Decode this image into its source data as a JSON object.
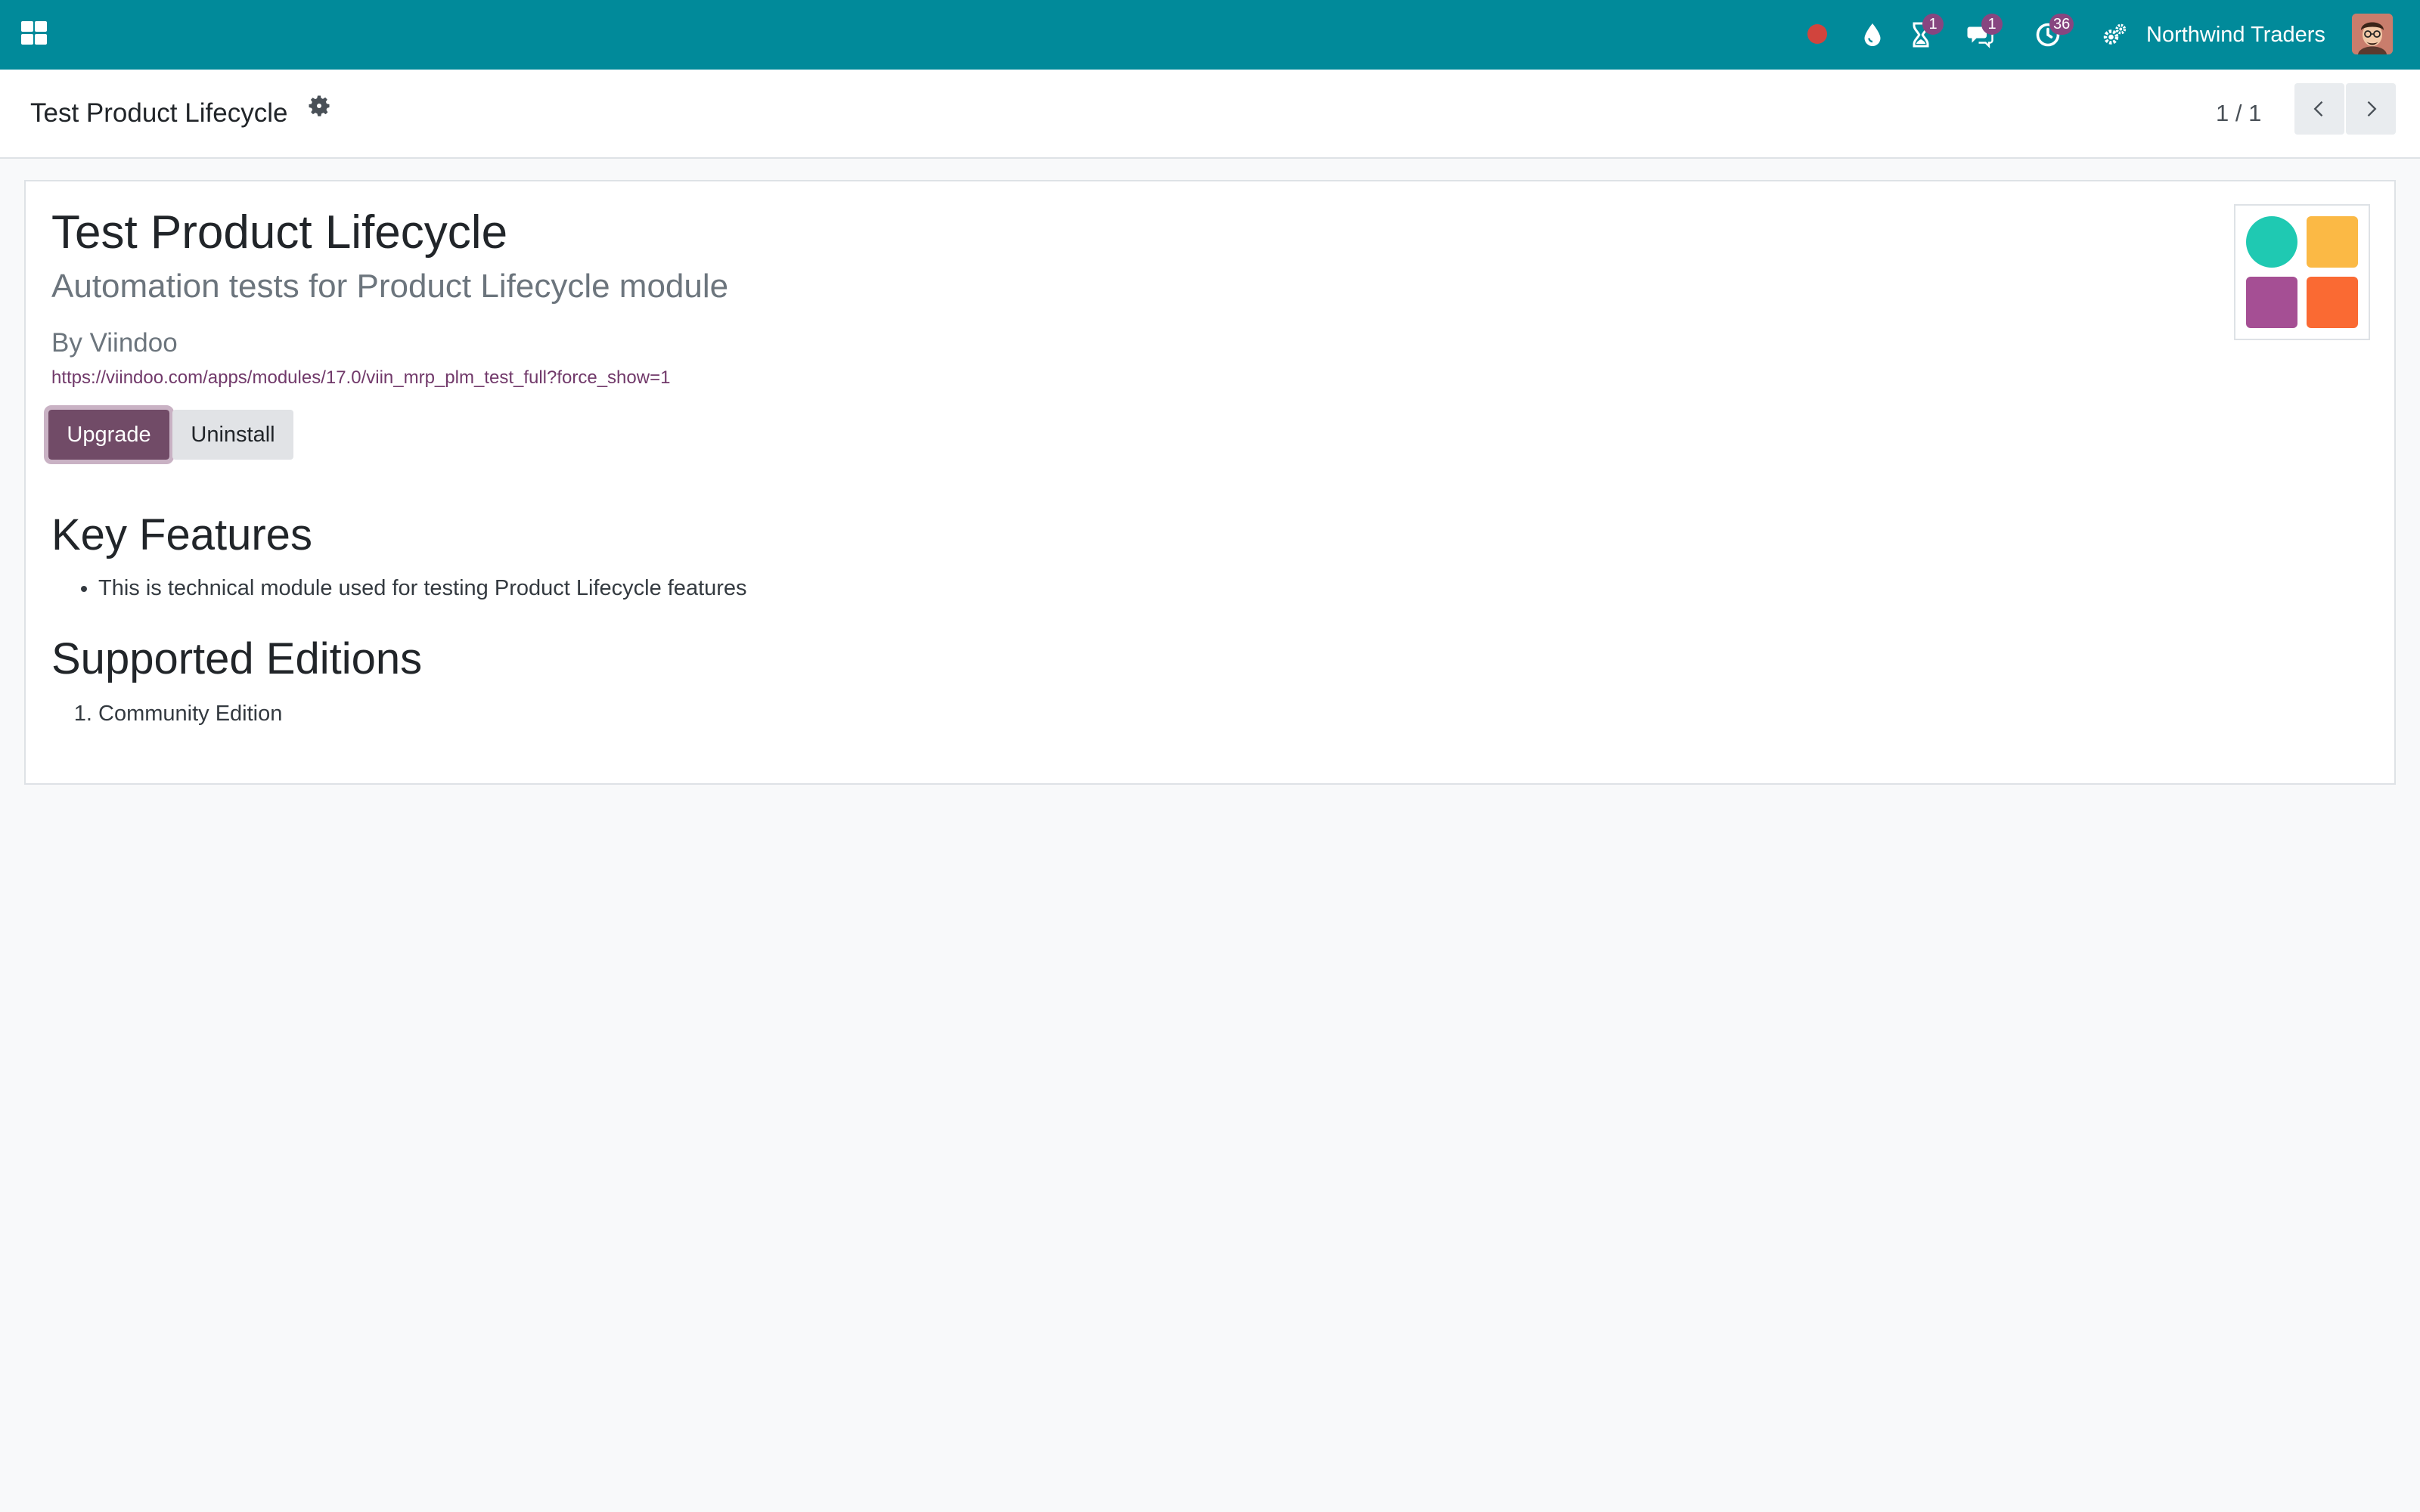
{
  "navbar": {
    "company": "Northwind Traders",
    "badges": {
      "activities": "1",
      "messages": "1",
      "timer": "36"
    },
    "colors": {
      "background": "#018a9a",
      "badge": "#874680",
      "record_dot": "#d1443d"
    },
    "icons": [
      "apps-grid-icon",
      "record-dot-icon",
      "drop-icon",
      "hourglass-icon",
      "chat-icon",
      "clock-icon",
      "settings-gears-icon",
      "user-avatar"
    ]
  },
  "control_panel": {
    "breadcrumb": "Test Product Lifecycle",
    "pager": "1 / 1"
  },
  "module": {
    "title": "Test Product Lifecycle",
    "summary": "Automation tests for Product Lifecycle module",
    "author": "By Viindoo",
    "url": "https://viindoo.com/apps/modules/17.0/viin_mrp_plm_test_full?force_show=1",
    "buttons": {
      "upgrade": "Upgrade",
      "uninstall": "Uninstall"
    },
    "key_features_heading": "Key Features",
    "features": [
      "This is technical module used for testing Product Lifecycle features"
    ],
    "editions_heading": "Supported Editions",
    "editions": [
      "Community Edition"
    ],
    "icon_colors": [
      "#1fc9b2",
      "#fbb945",
      "#a54f94",
      "#fa6a33"
    ]
  },
  "accent_colors": {
    "primary_button": "#714b67",
    "link": "#71396a"
  }
}
